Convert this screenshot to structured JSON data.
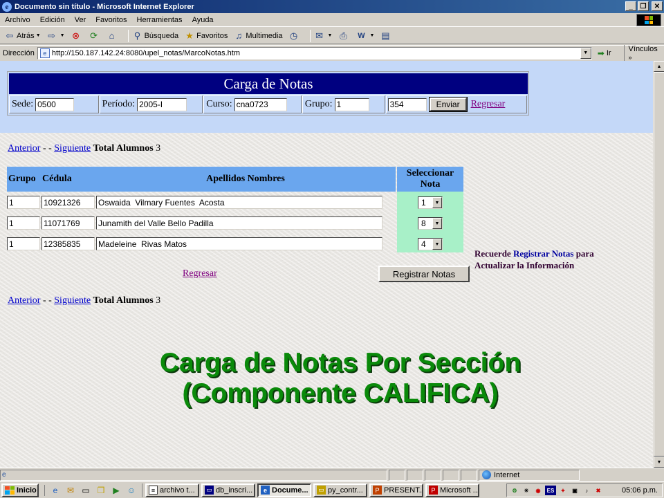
{
  "window": {
    "title": "Documento sin título - Microsoft Internet Explorer"
  },
  "menu": [
    "Archivo",
    "Edición",
    "Ver",
    "Favoritos",
    "Herramientas",
    "Ayuda"
  ],
  "toolbar": {
    "back": "Atrás",
    "search": "Búsqueda",
    "favorites": "Favoritos",
    "media": "Multimedia"
  },
  "address": {
    "label": "Dirección",
    "url": "http://150.187.142.24:8080/upel_notas/MarcoNotas.htm",
    "go": "Ir",
    "links": "Vínculos"
  },
  "form": {
    "title": "Carga de Notas",
    "sede_label": "Sede:",
    "sede_value": "0500",
    "periodo_label": "Período:",
    "periodo_value": "2005-I",
    "curso_label": "Curso:",
    "curso_value": "cna0723",
    "grupo_label": "Grupo:",
    "grupo_value": "1",
    "extra_value": "354",
    "submit": "Enviar",
    "back_link": "Regresar"
  },
  "nav": {
    "prev": "Anterior",
    "sep": "- -",
    "next": "Siguiente",
    "total_label": "Total Alumnos",
    "total_value": "3"
  },
  "table": {
    "headers": {
      "grupo": "Grupo",
      "cedula": "Cédula",
      "nombres": "Apellidos Nombres",
      "nota_l1": "Seleccionar",
      "nota_l2": "Nota"
    },
    "rows": [
      {
        "grupo": "1",
        "cedula": "10921326",
        "nombre": "Oswaida  Vilmary Fuentes  Acosta",
        "nota": "1"
      },
      {
        "grupo": "1",
        "cedula": "11071769",
        "nombre": "Junamith del Valle Bello Padilla",
        "nota": "8"
      },
      {
        "grupo": "1",
        "cedula": "12385835",
        "nombre": "Madeleine  Rivas Matos",
        "nota": "4"
      }
    ]
  },
  "reminder": {
    "p1": "Recuerde ",
    "p2": "Registrar Notas",
    "p3": " para",
    "line2": "Actualizar la Información"
  },
  "actions": {
    "register": "Registrar Notas",
    "back": "Regresar"
  },
  "caption": {
    "line1": "Carga de Notas Por Sección",
    "line2": "(Componente CALIFICA)"
  },
  "status": {
    "zone": "Internet"
  },
  "taskbar": {
    "start": "Inicio",
    "tasks": [
      "archivo t...",
      "db_inscri...",
      "Docume...",
      "py_contr...",
      "PRESENT...",
      "Microsoft ..."
    ],
    "lang": "ES",
    "clock": "05:06 p.m."
  }
}
